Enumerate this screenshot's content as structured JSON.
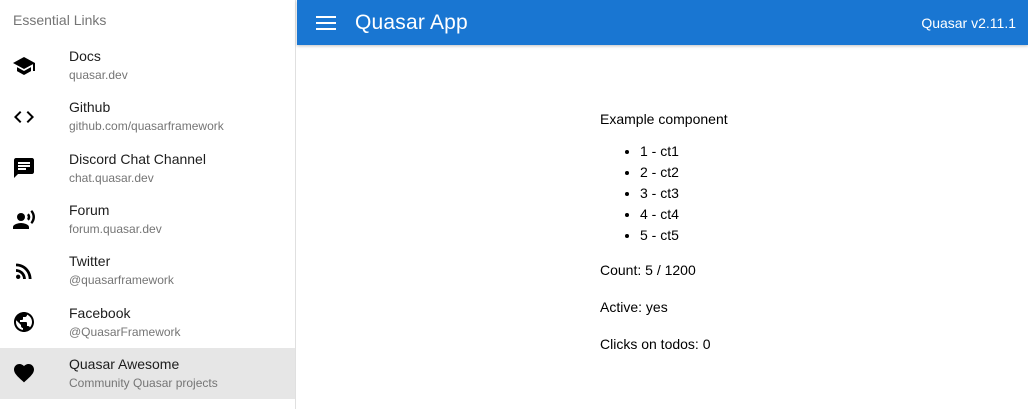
{
  "header": {
    "title": "Quasar App",
    "version": "Quasar v2.11.1",
    "color": "#1976d2"
  },
  "drawer": {
    "header": "Essential Links",
    "links": [
      {
        "title": "Docs",
        "caption": "quasar.dev",
        "icon": "school-icon"
      },
      {
        "title": "Github",
        "caption": "github.com/quasarframework",
        "icon": "code-icon"
      },
      {
        "title": "Discord Chat Channel",
        "caption": "chat.quasar.dev",
        "icon": "chat-icon"
      },
      {
        "title": "Forum",
        "caption": "forum.quasar.dev",
        "icon": "record-voice-icon"
      },
      {
        "title": "Twitter",
        "caption": "@quasarframework",
        "icon": "rss-icon"
      },
      {
        "title": "Facebook",
        "caption": "@QuasarFramework",
        "icon": "public-icon"
      },
      {
        "title": "Quasar Awesome",
        "caption": "Community Quasar projects",
        "icon": "favorite-icon"
      }
    ]
  },
  "main": {
    "component_title": "Example component",
    "todos": [
      "1 - ct1",
      "2 - ct2",
      "3 - ct3",
      "4 - ct4",
      "5 - ct5"
    ],
    "count": "Count: 5 / 1200",
    "active": "Active: yes",
    "clicks": "Clicks on todos: 0"
  }
}
